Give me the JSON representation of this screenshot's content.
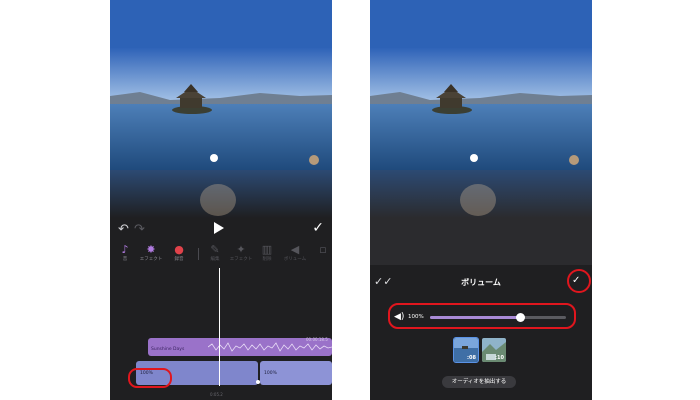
{
  "left_screen": {
    "toolbar": [
      {
        "label": "音",
        "icon": "music-note-icon",
        "style": "purple"
      },
      {
        "label": "エフェクト",
        "icon": "sparkle-icon",
        "style": "purple"
      },
      {
        "label": "録音",
        "icon": "microphone-icon",
        "style": "red"
      },
      {
        "label": "編集",
        "icon": "pencil-icon",
        "style": "dim"
      },
      {
        "label": "エフェクト",
        "icon": "effect-icon",
        "style": "dim"
      },
      {
        "label": "削除",
        "icon": "trash-icon",
        "style": "dim"
      },
      {
        "label": "ボリューム",
        "icon": "speaker-icon",
        "style": "dim"
      },
      {
        "label": "",
        "icon": "more-icon",
        "style": "dim"
      }
    ],
    "audio_clip_name": "Sunshine Days",
    "video_clip_volume_1": "100%",
    "video_clip_volume_2": "100%",
    "time_mid": "0:05.2",
    "time_right": "00:00:18.5"
  },
  "right_screen": {
    "panel_title": "ボリューム",
    "volume_label": "100%",
    "volume_level": 0.66,
    "thumbnails": [
      {
        "label": ":08",
        "selected": true
      },
      {
        "label": ":10",
        "selected": false
      }
    ],
    "extract_button": "オーディオを抽出する"
  },
  "colors": {
    "accent_purple": "#a98ad6",
    "highlight_red": "#e0161e",
    "panel_bg": "#1f1f21"
  }
}
